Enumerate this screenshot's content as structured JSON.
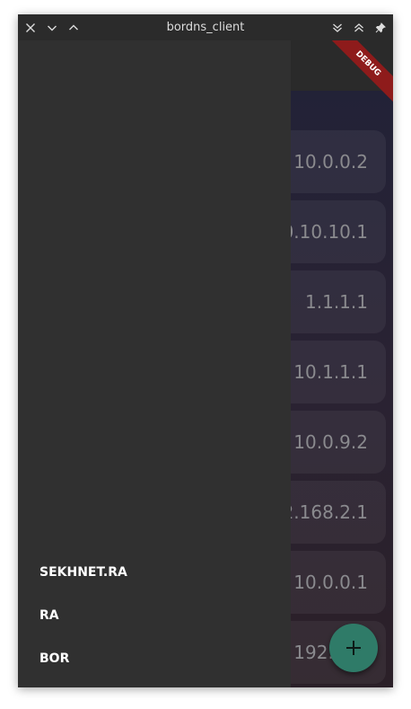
{
  "window": {
    "title": "bordns_client"
  },
  "icons": {
    "close": "close-icon",
    "minimize": "chevron-down-icon",
    "maximize": "chevron-up-icon",
    "shade": "double-chevron-down-icon",
    "unshade": "double-chevron-up-icon",
    "pin": "pin-icon",
    "add": "plus-icon"
  },
  "debug_banner": "DEBUG",
  "drawer": {
    "items": [
      {
        "label": "SEKHNET.RA"
      },
      {
        "label": "RA"
      },
      {
        "label": "BOR"
      }
    ]
  },
  "list": {
    "items": [
      {
        "value": "10.0.0.2"
      },
      {
        "value": "10.10.10.1"
      },
      {
        "value": "1.1.1.1"
      },
      {
        "value": "10.1.1.1"
      },
      {
        "value": "10.0.9.2"
      },
      {
        "value": "192.168.2.1"
      },
      {
        "value": "10.0.0.1"
      },
      {
        "value": "192.168"
      }
    ]
  },
  "colors": {
    "drawer": "#303030",
    "fab": "#2f7b68",
    "debug_banner": "#8e1b1b",
    "titlebar": "#2b2b2b"
  }
}
